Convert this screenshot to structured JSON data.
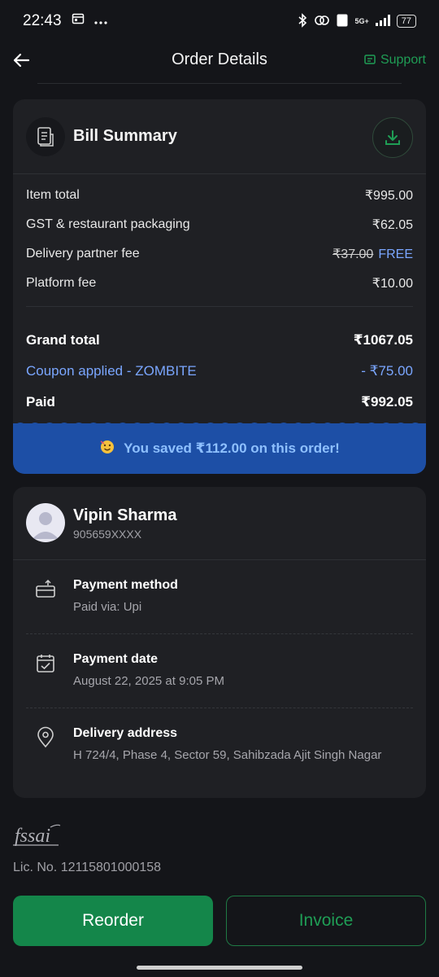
{
  "status_bar": {
    "time": "22:43",
    "network_label": "5G+",
    "battery": "77"
  },
  "header": {
    "title": "Order Details",
    "support_label": "Support"
  },
  "bill_summary": {
    "title": "Bill Summary",
    "rows": [
      {
        "label": "Item total",
        "value": "₹995.00"
      },
      {
        "label": "GST & restaurant packaging",
        "value": "₹62.05"
      },
      {
        "label": "Delivery partner fee",
        "original": "₹37.00",
        "value": "FREE"
      },
      {
        "label": "Platform fee",
        "value": "₹10.00"
      }
    ],
    "grand_total": {
      "label": "Grand total",
      "value": "₹1067.05"
    },
    "coupon": {
      "label": "Coupon applied - ZOMBITE",
      "value": "- ₹75.00"
    },
    "paid": {
      "label": "Paid",
      "value": "₹992.05"
    },
    "savings_text": "You saved ₹112.00 on this order!"
  },
  "customer": {
    "name": "Vipin Sharma",
    "phone": "905659XXXX"
  },
  "details": [
    {
      "title": "Payment method",
      "subtitle": "Paid via: Upi",
      "icon": "payment-icon"
    },
    {
      "title": "Payment date",
      "subtitle": "August 22, 2025 at 9:05 PM",
      "icon": "calendar-icon"
    },
    {
      "title": "Delivery address",
      "subtitle": "H 724/4, Phase 4, Sector 59, Sahibzada Ajit Singh Nagar",
      "icon": "location-pin-icon"
    }
  ],
  "footer": {
    "fssai_logo_text": "fssai",
    "license": "Lic. No. 12115801000158",
    "reorder_label": "Reorder",
    "invoice_label": "Invoice"
  },
  "colors": {
    "background": "#141519",
    "card": "#1f2024",
    "accent_green": "#14864a",
    "coupon_blue": "#7aa6ff",
    "savings_bg": "#1d4fa6"
  }
}
